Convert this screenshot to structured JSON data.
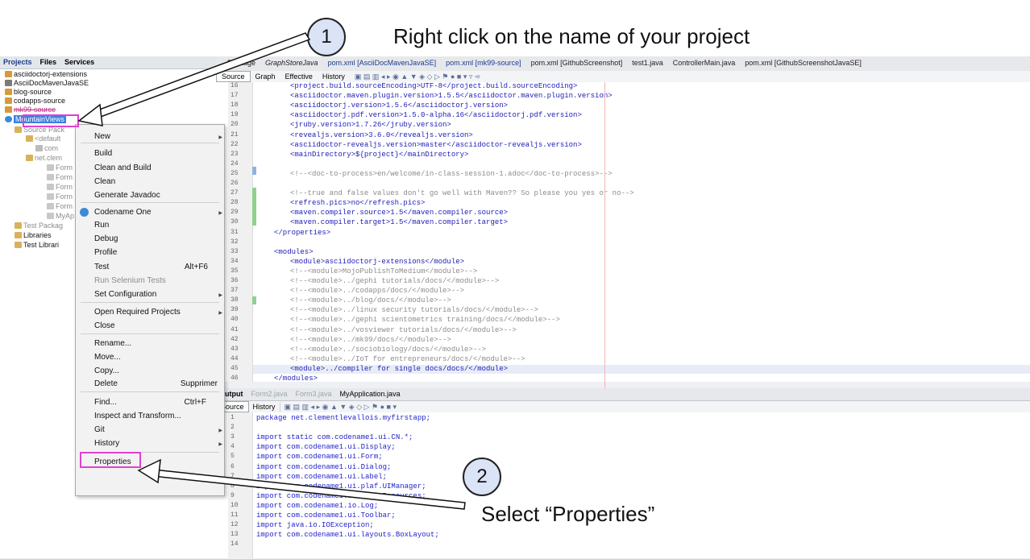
{
  "annotation": {
    "step1_number": "1",
    "step1_text": "Right click on the name of your project",
    "step2_number": "2",
    "step2_text": "Select “Properties”"
  },
  "panel_tabs": [
    "Projects",
    "Files",
    "Services"
  ],
  "tree": [
    {
      "label": "asciidoctorj-extensions"
    },
    {
      "label": "AsciiDocMavenJavaSE"
    },
    {
      "label": "blog-source"
    },
    {
      "label": "codapps-source"
    },
    {
      "label": "mk99-source"
    },
    {
      "label": "MountainViews"
    },
    {
      "label": "Source Pack"
    },
    {
      "label": "<default"
    },
    {
      "label": "com"
    },
    {
      "label": "net.clem"
    },
    {
      "label": "Form"
    },
    {
      "label": "Form"
    },
    {
      "label": "Form"
    },
    {
      "label": "Form"
    },
    {
      "label": "Form"
    },
    {
      "label": "MyAp"
    },
    {
      "label": "Test Packag"
    },
    {
      "label": "Libraries"
    },
    {
      "label": "Test Librari"
    }
  ],
  "context_menu": [
    {
      "label": "New",
      "shortcut": ""
    },
    {
      "label": "Build",
      "shortcut": ""
    },
    {
      "label": "Clean and Build",
      "shortcut": ""
    },
    {
      "label": "Clean",
      "shortcut": ""
    },
    {
      "label": "Generate Javadoc",
      "shortcut": ""
    },
    {
      "label": "Codename One",
      "shortcut": ""
    },
    {
      "label": "Run",
      "shortcut": ""
    },
    {
      "label": "Debug",
      "shortcut": ""
    },
    {
      "label": "Profile",
      "shortcut": ""
    },
    {
      "label": "Test",
      "shortcut": "Alt+F6"
    },
    {
      "label": "Run Selenium Tests",
      "shortcut": ""
    },
    {
      "label": "Set Configuration",
      "shortcut": ""
    },
    {
      "label": "Open Required Projects",
      "shortcut": ""
    },
    {
      "label": "Close",
      "shortcut": ""
    },
    {
      "label": "Rename...",
      "shortcut": ""
    },
    {
      "label": "Move...",
      "shortcut": ""
    },
    {
      "label": "Copy...",
      "shortcut": ""
    },
    {
      "label": "Delete",
      "shortcut": "Supprimer"
    },
    {
      "label": "Find...",
      "shortcut": "Ctrl+F"
    },
    {
      "label": "Inspect and Transform...",
      "shortcut": ""
    },
    {
      "label": "Git",
      "shortcut": ""
    },
    {
      "label": "History",
      "shortcut": ""
    },
    {
      "label": "Properties",
      "shortcut": ""
    }
  ],
  "editor_tabs": [
    "Package",
    "GraphStoreJava",
    "pom.xml [AsciiDocMavenJavaSE]",
    "pom.xml [mk99-source]",
    "pom.xml [GithubScreenshot]",
    "test1.java",
    "ControllerMain.java",
    "pom.xml [GithubScreenshotJavaSE]"
  ],
  "editor_toolbar": [
    "Source",
    "Graph",
    "Effective",
    "History"
  ],
  "editor_lines": [
    {
      "n": "16",
      "text": "<project.build.sourceEncoding>UTF-8</project.build.sourceEncoding>",
      "kind": "tag"
    },
    {
      "n": "17",
      "text": "<asciidoctor.maven.plugin.version>1.5.5</asciidoctor.maven.plugin.version>",
      "kind": "tag"
    },
    {
      "n": "18",
      "text": "<asciidoctorj.version>1.5.6</asciidoctorj.version>",
      "kind": "tag"
    },
    {
      "n": "19",
      "text": "<asciidoctorj.pdf.version>1.5.0-alpha.16</asciidoctorj.pdf.version>",
      "kind": "tag"
    },
    {
      "n": "20",
      "text": "<jruby.version>1.7.26</jruby.version>",
      "kind": "tag"
    },
    {
      "n": "21",
      "text": "<revealjs.version>3.6.0</revealjs.version>",
      "kind": "tag"
    },
    {
      "n": "22",
      "text": "<asciidoctor-revealjs.version>master</asciidoctor-revealjs.version>",
      "kind": "tag"
    },
    {
      "n": "23",
      "text": "<mainDirectory>${project}</mainDirectory>",
      "kind": "tag"
    },
    {
      "n": "24",
      "text": "",
      "kind": "tag"
    },
    {
      "n": "25",
      "text": "<!--<doc-to-process>en/welcome/in-class-session-1.adoc</doc-to-process>-->",
      "kind": "cmt"
    },
    {
      "n": "26",
      "text": "",
      "kind": "tag"
    },
    {
      "n": "27",
      "text": "<!--true and false values don't go well with Maven?? So please you yes or no-->",
      "kind": "cmt"
    },
    {
      "n": "28",
      "text": "<refresh.pics>no</refresh.pics>",
      "kind": "tag"
    },
    {
      "n": "29",
      "text": "<maven.compiler.source>1.5</maven.compiler.source>",
      "kind": "tag"
    },
    {
      "n": "30",
      "text": "<maven.compiler.target>1.5</maven.compiler.target>",
      "kind": "tag"
    },
    {
      "n": "31",
      "text": "</properties>",
      "kind": "tag0"
    },
    {
      "n": "32",
      "text": "",
      "kind": "tag"
    },
    {
      "n": "33",
      "text": "<modules>",
      "kind": "tag0"
    },
    {
      "n": "34",
      "text": "<module>asciidoctorj-extensions</module>",
      "kind": "tag"
    },
    {
      "n": "35",
      "text": "<!--<module>MojoPublishToMedium</module>-->",
      "kind": "cmt"
    },
    {
      "n": "36",
      "text": "<!--<module>../gephi tutorials/docs/</module>-->",
      "kind": "cmt"
    },
    {
      "n": "37",
      "text": "<!--<module>../codapps/docs/</module>-->",
      "kind": "cmt"
    },
    {
      "n": "38",
      "text": "<!--<module>../blog/docs/</module>-->",
      "kind": "cmt"
    },
    {
      "n": "39",
      "text": "<!--<module>../linux security tutorials/docs/</module>-->",
      "kind": "cmt"
    },
    {
      "n": "40",
      "text": "<!--<module>../gephi scientometrics training/docs/</module>-->",
      "kind": "cmt"
    },
    {
      "n": "41",
      "text": "<!--<module>../vosviewer tutorials/docs/</module>-->",
      "kind": "cmt"
    },
    {
      "n": "42",
      "text": "<!--<module>../mk99/docs/</module>-->",
      "kind": "cmt"
    },
    {
      "n": "43",
      "text": "<!--<module>../sociobiology/docs/</module>-->",
      "kind": "cmt"
    },
    {
      "n": "44",
      "text": "<!--<module>../IoT for entrepreneurs/docs/</module>-->",
      "kind": "cmt"
    },
    {
      "n": "45",
      "text": "<module>../compiler for single docs/docs/</module>",
      "kind": "tag"
    },
    {
      "n": "46",
      "text": "</modules>",
      "kind": "tag0"
    }
  ],
  "bottom_tabs": [
    "Output",
    "Form2.java",
    "Form3.java",
    "MyApplication.java"
  ],
  "bottom_toolbar": [
    "Source",
    "History"
  ],
  "java_lines": [
    {
      "n": "1",
      "text": "package net.clementlevallois.myfirstapp;"
    },
    {
      "n": "2",
      "text": ""
    },
    {
      "n": "3",
      "text": "import static com.codename1.ui.CN.*;"
    },
    {
      "n": "4",
      "text": "import com.codename1.ui.Display;"
    },
    {
      "n": "5",
      "text": "import com.codename1.ui.Form;"
    },
    {
      "n": "6",
      "text": "import com.codename1.ui.Dialog;"
    },
    {
      "n": "7",
      "text": "import com.codename1.ui.Label;"
    },
    {
      "n": "8",
      "text": "import com.codename1.ui.plaf.UIManager;"
    },
    {
      "n": "9",
      "text": "import com.codename1.ui.util.Resources;"
    },
    {
      "n": "10",
      "text": "import com.codename1.io.Log;"
    },
    {
      "n": "11",
      "text": "import com.codename1.ui.Toolbar;"
    },
    {
      "n": "12",
      "text": "import java.io.IOException;"
    },
    {
      "n": "13",
      "text": "import com.codename1.ui.layouts.BoxLayout;"
    },
    {
      "n": "14",
      "text": ""
    }
  ]
}
